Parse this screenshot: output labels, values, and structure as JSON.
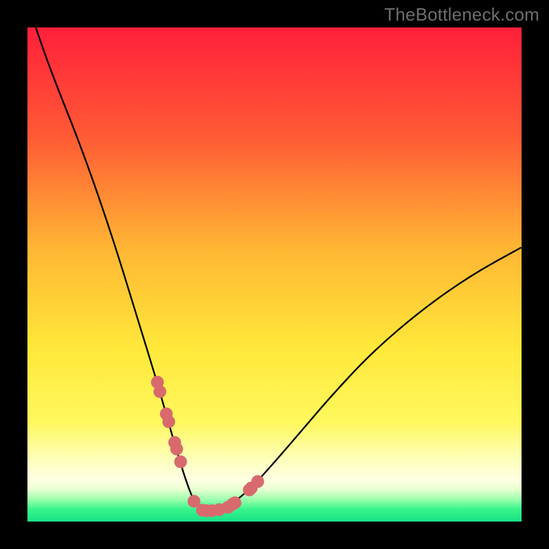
{
  "watermark": "TheBottleneck.com",
  "colors": {
    "frame": "#000000",
    "curve_stroke": "#000000",
    "marker_fill": "#d86a6e",
    "marker_stroke": "#d86a6e",
    "gradient_stops": [
      {
        "offset": 0.0,
        "color": "#ff1f3a"
      },
      {
        "offset": 0.22,
        "color": "#ff5a35"
      },
      {
        "offset": 0.45,
        "color": "#ffb734"
      },
      {
        "offset": 0.65,
        "color": "#ffe83a"
      },
      {
        "offset": 0.8,
        "color": "#fff85f"
      },
      {
        "offset": 0.88,
        "color": "#fdffc1"
      },
      {
        "offset": 0.915,
        "color": "#ffffe3"
      },
      {
        "offset": 0.935,
        "color": "#e7ffd0"
      },
      {
        "offset": 0.955,
        "color": "#9dffae"
      },
      {
        "offset": 0.975,
        "color": "#38f58a"
      },
      {
        "offset": 1.0,
        "color": "#18e187"
      }
    ]
  },
  "chart_data": {
    "type": "line",
    "title": "",
    "xlabel": "",
    "ylabel": "",
    "xlim": [
      0,
      100
    ],
    "ylim": [
      0,
      100
    ],
    "series": [
      {
        "name": "bottleneck-curve",
        "x": [
          0,
          3,
          6,
          10,
          14,
          18,
          22,
          26,
          28,
          30,
          32,
          33.5,
          35,
          37,
          39,
          41,
          45,
          50,
          56,
          62,
          70,
          80,
          90,
          100
        ],
        "y": [
          105,
          96,
          88,
          78,
          67,
          55,
          42,
          29,
          22,
          15,
          8.5,
          4.5,
          2.4,
          2.2,
          2.5,
          3.3,
          6.5,
          12,
          19,
          26,
          34.5,
          43,
          50,
          55.5
        ]
      }
    ],
    "markers": {
      "name": "highlight-points",
      "x": [
        26.3,
        26.8,
        28.1,
        28.6,
        29.8,
        30.2,
        31.0,
        33.7,
        35.4,
        36.2,
        37.3,
        38.8,
        40.6,
        41.5,
        42.0,
        44.9,
        45.3,
        46.6
      ],
      "y": [
        28.2,
        26.3,
        21.8,
        20.2,
        16.0,
        14.7,
        12.1,
        4.1,
        2.3,
        2.2,
        2.2,
        2.4,
        2.9,
        3.5,
        3.8,
        6.4,
        6.8,
        8.1
      ]
    }
  }
}
